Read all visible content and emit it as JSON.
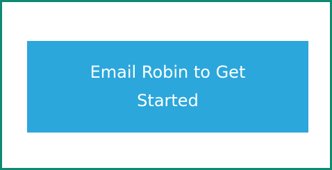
{
  "colors": {
    "border": "#0f8a72",
    "button_background": "#2ba7dc",
    "button_text": "#ffffff",
    "page_background": "#ffffff"
  },
  "cta": {
    "label": "Email Robin to Get Started"
  }
}
